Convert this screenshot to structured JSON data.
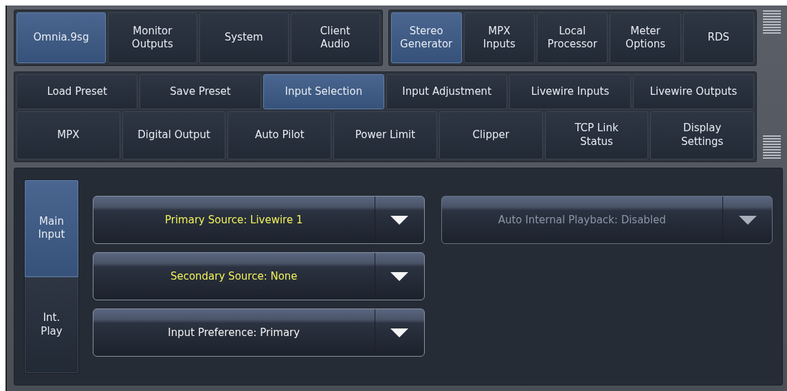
{
  "main_tabs": [
    {
      "items": [
        {
          "label": "Omnia.9sg",
          "selected": true
        },
        {
          "label": "Monitor\nOutputs",
          "selected": false
        },
        {
          "label": "System",
          "selected": false
        },
        {
          "label": "Client\nAudio",
          "selected": false
        }
      ]
    },
    {
      "items": [
        {
          "label": "Stereo\nGenerator",
          "selected": true
        },
        {
          "label": "MPX\nInputs",
          "selected": false
        },
        {
          "label": "Local\nProcessor",
          "selected": false
        },
        {
          "label": "Meter\nOptions",
          "selected": false
        },
        {
          "label": "RDS",
          "selected": false
        }
      ]
    }
  ],
  "sub_tabs": [
    [
      {
        "label": "Load Preset",
        "selected": false
      },
      {
        "label": "Save Preset",
        "selected": false
      },
      {
        "label": "Input Selection",
        "selected": true
      },
      {
        "label": "Input Adjustment",
        "selected": false
      },
      {
        "label": "Livewire Inputs",
        "selected": false
      },
      {
        "label": "Livewire Outputs",
        "selected": false
      }
    ],
    [
      {
        "label": "MPX",
        "selected": false
      },
      {
        "label": "Digital Output",
        "selected": false
      },
      {
        "label": "Auto Pilot",
        "selected": false
      },
      {
        "label": "Power Limit",
        "selected": false
      },
      {
        "label": "Clipper",
        "selected": false
      },
      {
        "label": "TCP Link\nStatus",
        "selected": false
      },
      {
        "label": "Display\nSettings",
        "selected": false
      }
    ]
  ],
  "side_tabs": [
    {
      "label": "Main\nInput",
      "selected": true
    },
    {
      "label": "Int.\nPlay",
      "selected": false
    }
  ],
  "input_dropdowns": [
    {
      "label": "Primary Source: Livewire 1",
      "highlighted": true,
      "disabled": false
    },
    {
      "label": "Secondary Source: None",
      "highlighted": true,
      "disabled": false
    },
    {
      "label": "Input Preference: Primary",
      "highlighted": false,
      "disabled": false
    }
  ],
  "playback_dropdowns": [
    {
      "label": "Auto Internal Playback: Disabled",
      "highlighted": false,
      "disabled": true
    }
  ]
}
